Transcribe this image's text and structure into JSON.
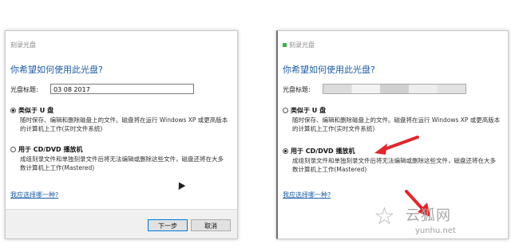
{
  "left_dialog": {
    "title": "刻录光盘",
    "heading": "你希望如何使用此光盘?",
    "disc_label_caption": "光盘标题:",
    "disc_label_value": "03 08 2017",
    "option1_title": "类似于 U 盘",
    "option1_desc": "随时保存、编辑和删除磁盘上的文件。磁盘将在运行 Windows XP 或更高版本的计算机上工作(实时文件系统)",
    "option2_title": "用于 CD/DVD 播放机",
    "option2_desc": "成组刻录文件和单独刻录文件后将无法编辑或删除这些文件，磁盘还将在大多数计算机上工作(Mastered)",
    "help_link": "我应选择哪一种?",
    "next_button": "下一步",
    "cancel_button": "取消"
  },
  "right_dialog": {
    "title": "刻录光盘",
    "heading": "你希望如何使用此光盘?",
    "disc_label_caption": "光盘标题:",
    "option1_title": "类似于 U 盘",
    "option1_desc": "随时保存、编辑和删除磁盘上的文件。磁盘将在运行 Windows XP 或更高版本的计算机上工作(实时文件系统)",
    "option2_title": "用于 CD/DVD 播放机",
    "option2_desc": "成组刻录文件和单独刻录文件后将无法编辑或删除这些文件，磁盘还将在大多数计算机上工作(Mastered)",
    "help_link": "我应选择哪一种?"
  },
  "watermark": {
    "text": "云狐网",
    "url": "yunhu.net"
  },
  "colors": {
    "accent": "#1e5da6",
    "arrow": "#e0272e"
  }
}
